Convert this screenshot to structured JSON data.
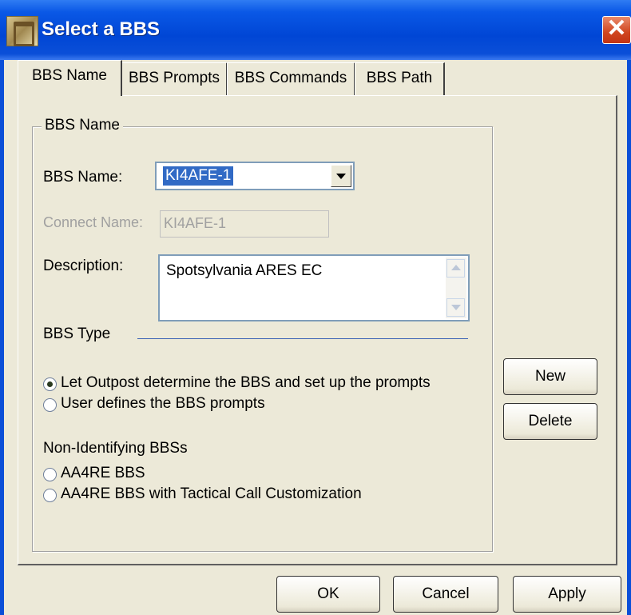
{
  "window": {
    "title": "Select a BBS",
    "close_glyph": "✕"
  },
  "tabs": [
    {
      "label": "BBS Name",
      "active": true
    },
    {
      "label": "BBS Prompts",
      "active": false
    },
    {
      "label": "BBS Commands",
      "active": false
    },
    {
      "label": "BBS Path",
      "active": false
    }
  ],
  "group": {
    "caption": "BBS Name"
  },
  "form": {
    "bbs_name_label": "BBS Name:",
    "bbs_name_value": "KI4AFE-1",
    "connect_name_label": "Connect Name:",
    "connect_name_value": "KI4AFE-1",
    "description_label": "Description:",
    "description_value": "Spotsylvania ARES EC",
    "bbs_type_label": "BBS Type",
    "radio_auto": "Let Outpost determine the BBS and set up the prompts",
    "radio_user": "User defines the BBS prompts",
    "non_identifying_label": "Non-Identifying BBSs",
    "radio_aa4re": "AA4RE BBS",
    "radio_aa4re_tactical": "AA4RE BBS with Tactical Call Customization",
    "selected_radio": "radio_auto"
  },
  "side_buttons": {
    "new": "New",
    "delete": "Delete"
  },
  "footer_buttons": {
    "ok": "OK",
    "cancel": "Cancel",
    "apply": "Apply"
  },
  "colors": {
    "title_bar": "#0046d5",
    "dialog_bg": "#ece9d8",
    "selection": "#316ac5",
    "close_button": "#d0451f"
  }
}
